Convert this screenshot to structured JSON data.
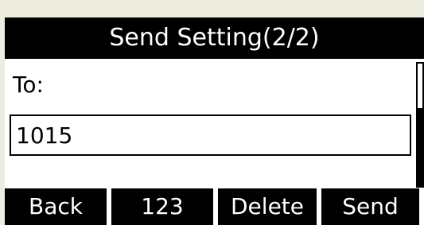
{
  "screen": {
    "title": "Send Setting(2/2)"
  },
  "form": {
    "to_label": "To:",
    "to_value": "1015"
  },
  "softkeys": {
    "back": "Back",
    "mode": "123",
    "delete": "Delete",
    "send": "Send"
  },
  "colors": {
    "foreground": "#000000",
    "background": "#ffffff",
    "bezel": "#ececdf"
  }
}
